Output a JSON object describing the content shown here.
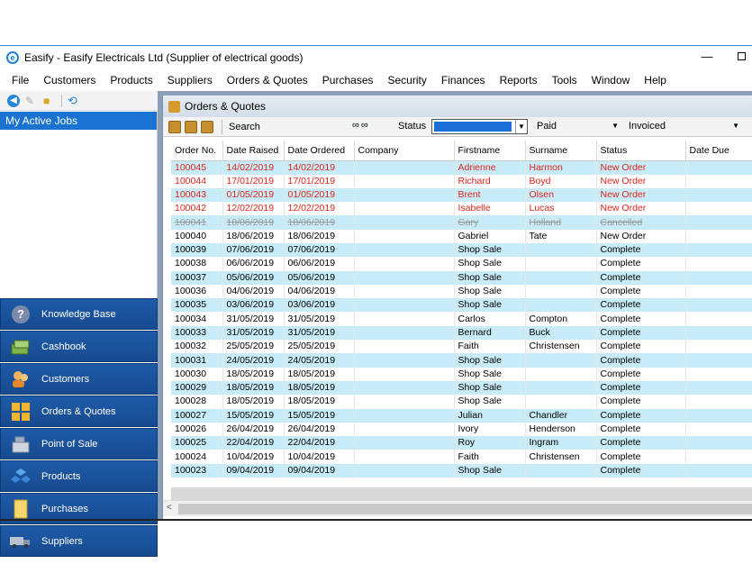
{
  "window": {
    "title": "Easify - Easify Electricals Ltd (Supplier of electrical goods)",
    "icon_letter": "e",
    "min_glyph": "—"
  },
  "menu": [
    "File",
    "Customers",
    "Products",
    "Suppliers",
    "Orders & Quotes",
    "Purchases",
    "Security",
    "Finances",
    "Reports",
    "Tools",
    "Window",
    "Help"
  ],
  "left_panel": {
    "active_jobs_title": "My Active Jobs"
  },
  "nav": [
    {
      "label": "Knowledge Base",
      "icon": "question-icon"
    },
    {
      "label": "Cashbook",
      "icon": "cashbook-icon"
    },
    {
      "label": "Customers",
      "icon": "customers-icon"
    },
    {
      "label": "Orders & Quotes",
      "icon": "orders-icon"
    },
    {
      "label": "Point of Sale",
      "icon": "till-icon"
    },
    {
      "label": "Products",
      "icon": "products-icon"
    },
    {
      "label": "Purchases",
      "icon": "purchases-icon"
    },
    {
      "label": "Suppliers",
      "icon": "truck-icon"
    }
  ],
  "doc": {
    "title": "Orders & Quotes",
    "toolbar": {
      "search_label": "Search",
      "status_label": "Status",
      "paid_value": "Paid",
      "invoiced_value": "Invoiced"
    }
  },
  "table": {
    "columns": [
      "Order No.",
      "Date Raised",
      "Date Ordered",
      "Company",
      "Firstname",
      "Surname",
      "Status",
      "Date Due"
    ],
    "rows": [
      [
        "100045",
        "14/02/2019",
        "14/02/2019",
        "",
        "Adrienne",
        "Harmon",
        "New Order",
        ""
      ],
      [
        "100044",
        "17/01/2019",
        "17/01/2019",
        "",
        "Richard",
        "Boyd",
        "New Order",
        ""
      ],
      [
        "100043",
        "01/05/2019",
        "01/05/2019",
        "",
        "Brent",
        "Olsen",
        "New Order",
        ""
      ],
      [
        "100042",
        "12/02/2019",
        "12/02/2019",
        "",
        "Isabelle",
        "Lucas",
        "New Order",
        ""
      ],
      [
        "100041",
        "18/06/2019",
        "18/06/2019",
        "",
        "Gary",
        "Holland",
        "Cancelled",
        ""
      ],
      [
        "100040",
        "18/06/2019",
        "18/06/2019",
        "",
        "Gabriel",
        "Tate",
        "New Order",
        ""
      ],
      [
        "100039",
        "07/06/2019",
        "07/06/2019",
        "",
        "Shop Sale",
        "",
        "Complete",
        ""
      ],
      [
        "100038",
        "06/06/2019",
        "06/06/2019",
        "",
        "Shop Sale",
        "",
        "Complete",
        ""
      ],
      [
        "100037",
        "05/06/2019",
        "05/06/2019",
        "",
        "Shop Sale",
        "",
        "Complete",
        ""
      ],
      [
        "100036",
        "04/06/2019",
        "04/06/2019",
        "",
        "Shop Sale",
        "",
        "Complete",
        ""
      ],
      [
        "100035",
        "03/06/2019",
        "03/06/2019",
        "",
        "Shop Sale",
        "",
        "Complete",
        ""
      ],
      [
        "100034",
        "31/05/2019",
        "31/05/2019",
        "",
        "Carlos",
        "Compton",
        "Complete",
        ""
      ],
      [
        "100033",
        "31/05/2019",
        "31/05/2019",
        "",
        "Bernard",
        "Buck",
        "Complete",
        ""
      ],
      [
        "100032",
        "25/05/2019",
        "25/05/2019",
        "",
        "Faith",
        "Christensen",
        "Complete",
        ""
      ],
      [
        "100031",
        "24/05/2019",
        "24/05/2019",
        "",
        "Shop Sale",
        "",
        "Complete",
        ""
      ],
      [
        "100030",
        "18/05/2019",
        "18/05/2019",
        "",
        "Shop Sale",
        "",
        "Complete",
        ""
      ],
      [
        "100029",
        "18/05/2019",
        "18/05/2019",
        "",
        "Shop Sale",
        "",
        "Complete",
        ""
      ],
      [
        "100028",
        "18/05/2019",
        "18/05/2019",
        "",
        "Shop Sale",
        "",
        "Complete",
        ""
      ],
      [
        "100027",
        "15/05/2019",
        "15/05/2019",
        "",
        "Julian",
        "Chandler",
        "Complete",
        ""
      ],
      [
        "100026",
        "26/04/2019",
        "26/04/2019",
        "",
        "Ivory",
        "Henderson",
        "Complete",
        ""
      ],
      [
        "100025",
        "22/04/2019",
        "22/04/2019",
        "",
        "Roy",
        "Ingram",
        "Complete",
        ""
      ],
      [
        "100024",
        "10/04/2019",
        "10/04/2019",
        "",
        "Faith",
        "Christensen",
        "Complete",
        ""
      ],
      [
        "100023",
        "09/04/2019",
        "09/04/2019",
        "",
        "Shop Sale",
        "",
        "Complete",
        ""
      ]
    ],
    "row_styles": [
      "red",
      "red",
      "red",
      "red",
      "strike",
      "",
      "",
      "",
      "",
      "",
      "",
      "",
      "",
      "",
      "",
      "",
      "",
      "",
      "",
      "",
      "",
      "",
      ""
    ]
  },
  "colors": {
    "accent": "#1a73d1",
    "nav_bg": "#1f5ba8",
    "row_alt": "#c8ecf7",
    "new_order_red": "#e0241b"
  }
}
